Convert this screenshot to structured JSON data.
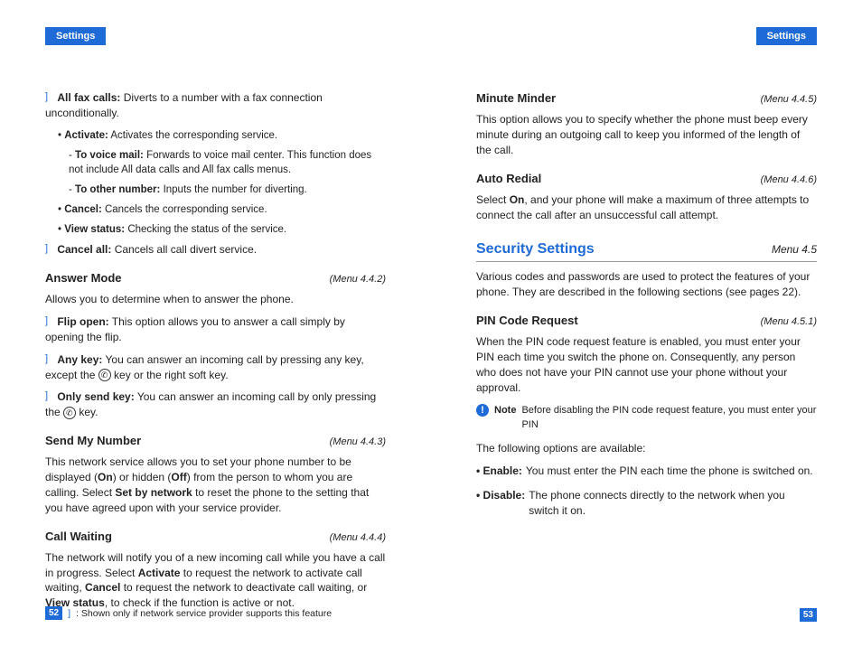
{
  "header": "Settings",
  "left": {
    "allFax": {
      "label": "All fax calls:",
      "text": " Diverts to a number with a fax connection unconditionally."
    },
    "activate": {
      "label": "Activate:",
      "text": " Activates the corresponding service."
    },
    "toVm": {
      "label": "To voice mail:",
      "text": " Forwards to voice mail center. This function does not include All data calls and All fax calls menus."
    },
    "toOther": {
      "label": "To other number:",
      "text": " Inputs the number for diverting."
    },
    "cancel": {
      "label": "Cancel:",
      "text": " Cancels the corresponding service."
    },
    "viewStatus": {
      "label": "View status:",
      "text": " Checking the status of the service."
    },
    "cancelAll": {
      "label": "Cancel all:",
      "text": " Cancels all call divert service."
    },
    "answerMode": {
      "title": "Answer Mode",
      "menu": "(Menu 4.4.2)",
      "intro": "Allows you to determine when to answer the phone."
    },
    "flipOpen": {
      "label": "Flip open:",
      "text": " This option allows you to answer a call simply by opening the flip."
    },
    "anyKey": {
      "label": "Any key:",
      "text1": " You can answer an incoming call by pressing any key, except the ",
      "text2": " key or the right soft key."
    },
    "onlySend": {
      "label": "Only send key:",
      "text1": " You can answer an incoming call by only pressing the ",
      "text2": " key."
    },
    "sendMyNumber": {
      "title": "Send My Number",
      "menu": "(Menu 4.4.3)",
      "p1a": "This network service allows you to set your phone number to be displayed (",
      "on": "On",
      "p1b": ") or hidden (",
      "off": "Off",
      "p1c": ") from the person to whom you are calling. Select ",
      "setby": "Set by network",
      "p1d": " to reset the phone to the setting that you have agreed upon with your service provider."
    },
    "callWaiting": {
      "title": "Call Waiting",
      "menu": "(Menu 4.4.4)",
      "p1a": "The network will notify you of a new incoming call while you have a call in progress. Select ",
      "activate": "Activate",
      "p1b": " to request the network to activate call waiting, ",
      "cancel": "Cancel",
      "p1c": " to request the network to deactivate call waiting, or ",
      "view": "View status",
      "p1d": ", to check if the function is active or not."
    },
    "footnote": ": Shown only if network service provider supports this feature",
    "pageNum": "52"
  },
  "right": {
    "minuteMinder": {
      "title": "Minute Minder",
      "menu": "(Menu 4.4.5)",
      "text": "This option allows you to specify whether the phone must beep every minute during an outgoing call to keep you informed of the length of the call."
    },
    "autoRedial": {
      "title": "Auto Redial",
      "menu": "(Menu 4.4.6)",
      "p1a": "Select ",
      "on": "On",
      "p1b": ", and your phone will make a maximum of three attempts to connect the call after an unsuccessful call attempt."
    },
    "security": {
      "title": "Security Settings",
      "menu": "Menu 4.5",
      "text": "Various codes and passwords are used to protect the features of your phone. They are described in the following sections (see pages 22)."
    },
    "pinCode": {
      "title": "PIN Code Request",
      "menu": "(Menu 4.5.1)",
      "text": "When the PIN code request feature is enabled, you must enter your PIN each time you switch the phone on. Consequently, any person who does not have your PIN cannot use your phone without your approval."
    },
    "note": {
      "label": "Note",
      "text": "Before disabling the PIN code request feature, you must enter your PIN"
    },
    "optsIntro": "The following options are available:",
    "enable": {
      "label": "• Enable:",
      "text": "You must enter the PIN each time the phone is switched on."
    },
    "disable": {
      "label": "• Disable:",
      "text": "The phone connects directly to the network when you switch it on."
    },
    "pageNum": "53"
  }
}
